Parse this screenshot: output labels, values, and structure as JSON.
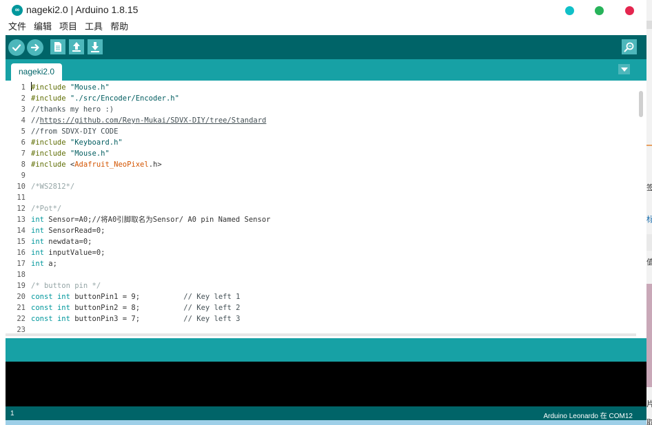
{
  "window": {
    "title": "nageki2.0 | Arduino 1.8.15",
    "controls": {
      "minimize_color": "#10c0c8",
      "maximize_color": "#27b35a",
      "close_color": "#e4264f"
    }
  },
  "menu": [
    "文件",
    "编辑",
    "项目",
    "工具",
    "帮助"
  ],
  "toolbar": {
    "buttons": [
      "verify-icon",
      "upload-icon",
      "new-icon",
      "open-icon",
      "save-icon"
    ],
    "serial_monitor": "serial-monitor-icon"
  },
  "tabs": [
    {
      "label": "nageki2.0",
      "active": true
    }
  ],
  "editor": {
    "line_numbers": [
      "1",
      "2",
      "3",
      "4",
      "5",
      "6",
      "7",
      "8",
      "9",
      "10",
      "11",
      "12",
      "13",
      "14",
      "15",
      "16",
      "17",
      "18",
      "19",
      "20",
      "21",
      "22",
      "23"
    ],
    "lines": {
      "l1": {
        "directive": "#include",
        "value": " \"Mouse.h\""
      },
      "l2": {
        "directive": "#include",
        "value": " \"./src/Encoder/Encoder.h\""
      },
      "l3": "//thanks my hero :)",
      "l4": {
        "prefix": "//",
        "link": "https://github.com/Reyn-Mukai/SDVX-DIY/tree/Standard"
      },
      "l5": "//from SDVX-DIY CODE",
      "l6": {
        "directive": "#include",
        "value": " \"Keyboard.h\""
      },
      "l7": {
        "directive": "#include",
        "value": " \"Mouse.h\""
      },
      "l8": {
        "directive": "#include",
        "open": " <",
        "lib": "Adafruit_NeoPixel",
        "close": ".h>"
      },
      "l10": "/*WS2812*/",
      "l12": "/*Pot*/",
      "l13": {
        "type": "int",
        "rest": " Sensor=A0;//将A0引脚取名为Sensor/ A0 pin Named Sensor"
      },
      "l14": {
        "type": "int",
        "rest": " SensorRead=0;"
      },
      "l15": {
        "type": "int",
        "rest": " newdata=0;"
      },
      "l16": {
        "type": "int",
        "rest": " inputValue=0;"
      },
      "l17": {
        "type": "int",
        "rest": " a;"
      },
      "l19": "/* button pin */",
      "l20": {
        "qual": "const",
        "type": "int",
        "rest": " buttonPin1 = 9;          ",
        "comment": "// Key left 1"
      },
      "l21": {
        "qual": "const",
        "type": "int",
        "rest": " buttonPin2 = 8;          ",
        "comment": "// Key left 2"
      },
      "l22": {
        "qual": "const",
        "type": "int",
        "rest": " buttonPin3 = 7;          ",
        "comment": "// Key left 3"
      }
    }
  },
  "status": {
    "line": "1",
    "board": "Arduino Leonardo 在 COM12"
  },
  "background_fragments": [
    "签",
    "标",
    "值",
    "片",
    "取消标签"
  ],
  "colors": {
    "toolbar": "#006468",
    "tabbar": "#17a1a5",
    "button": "#4db7bb",
    "console": "#000000"
  }
}
